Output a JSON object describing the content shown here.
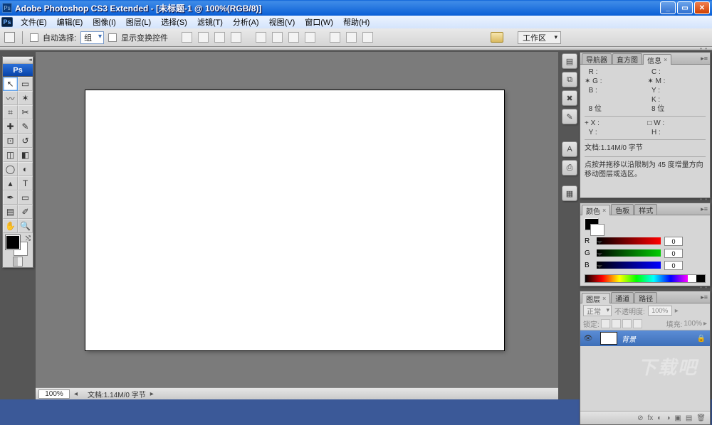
{
  "title": "Adobe Photoshop CS3 Extended - [未标题-1 @ 100%(RGB/8)]",
  "menubar": {
    "ps": "Ps",
    "items": [
      "文件(E)",
      "编辑(E)",
      "图像(I)",
      "图层(L)",
      "选择(S)",
      "滤镜(T)",
      "分析(A)",
      "视图(V)",
      "窗口(W)",
      "帮助(H)"
    ]
  },
  "optbar": {
    "auto_select": "自动选择:",
    "group": "组",
    "show_transform": "显示变换控件",
    "workspace": "工作区"
  },
  "status": {
    "zoom": "100%",
    "docinfo": "文档:1.14M/0 字节"
  },
  "panel_nav": {
    "tabs": [
      "导航器",
      "直方图",
      "信息"
    ],
    "active": 2,
    "r": "R :",
    "g": "G :",
    "b": "B :",
    "c": "C :",
    "m": "M :",
    "y": "Y :",
    "k": "K :",
    "bit1": "8 位",
    "bit2": "8 位",
    "x": "X :",
    "yy": "Y :",
    "w": "W :",
    "h": "H :",
    "docline": "文档:1.14M/0 字节",
    "hint": "点按并拖移以沿限制为 45 度增量方向移动图层或选区。"
  },
  "panel_col": {
    "tabs": [
      "颜色",
      "色板",
      "样式"
    ],
    "active": 0,
    "r": "R",
    "g": "G",
    "b": "B",
    "rv": "0",
    "gv": "0",
    "bv": "0"
  },
  "panel_lay": {
    "tabs": [
      "图层",
      "通道",
      "路径"
    ],
    "active": 0,
    "blend": "正常",
    "opacity_l": "不透明度:",
    "opacity_v": "100%",
    "lock_l": "锁定:",
    "fill_l": "填充:",
    "fill_v": "100%",
    "layer_name": "背景"
  },
  "watermark": "下载吧",
  "tool_icons": [
    "▣",
    "↘",
    "⊞",
    "✎",
    "◐",
    "⟋",
    "⟆",
    "⌫",
    "⊡",
    "◧",
    "⊙",
    "◩",
    "✏",
    "⎚",
    "⬚",
    "◆",
    "↖",
    "T",
    "⤢",
    "⬭",
    "✋",
    "⌕",
    "⇅",
    "⤾"
  ]
}
